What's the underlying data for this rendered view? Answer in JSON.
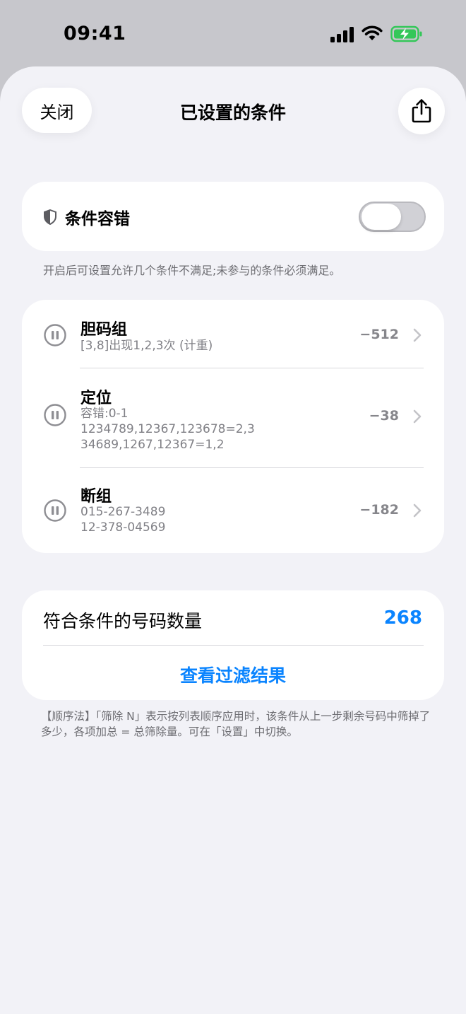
{
  "status_bar": {
    "time": "09:41"
  },
  "header": {
    "close_label": "关闭",
    "title": "已设置的条件",
    "share_icon": "share-icon"
  },
  "tolerance": {
    "label": "条件容错",
    "enabled": false,
    "note": "开启后可设置允许几个条件不满足;未参与的条件必须满足。"
  },
  "conditions": [
    {
      "title": "胆码组",
      "lines": [
        "[3,8]出现1,2,3次 (计重)"
      ],
      "count": "−512"
    },
    {
      "title": "定位",
      "lines": [
        "容错:0-1",
        "1234789,12367,123678=2,3",
        "34689,1267,12367=1,2"
      ],
      "count": "−38"
    },
    {
      "title": "断组",
      "lines": [
        "015-267-3489",
        "12-378-04569"
      ],
      "count": "−182"
    }
  ],
  "result": {
    "label": "符合条件的号码数量",
    "value": "268",
    "link": "查看过滤结果"
  },
  "footnote": "【顺序法】「筛除 N」表示按列表顺序应用时，该条件从上一步剩余号码中筛掉了多少，各项加总 = 总筛除量。可在「设置」中切换。",
  "colors": {
    "accent": "#0a84ff",
    "background": "#f2f2f7",
    "battery": "#34c759"
  }
}
